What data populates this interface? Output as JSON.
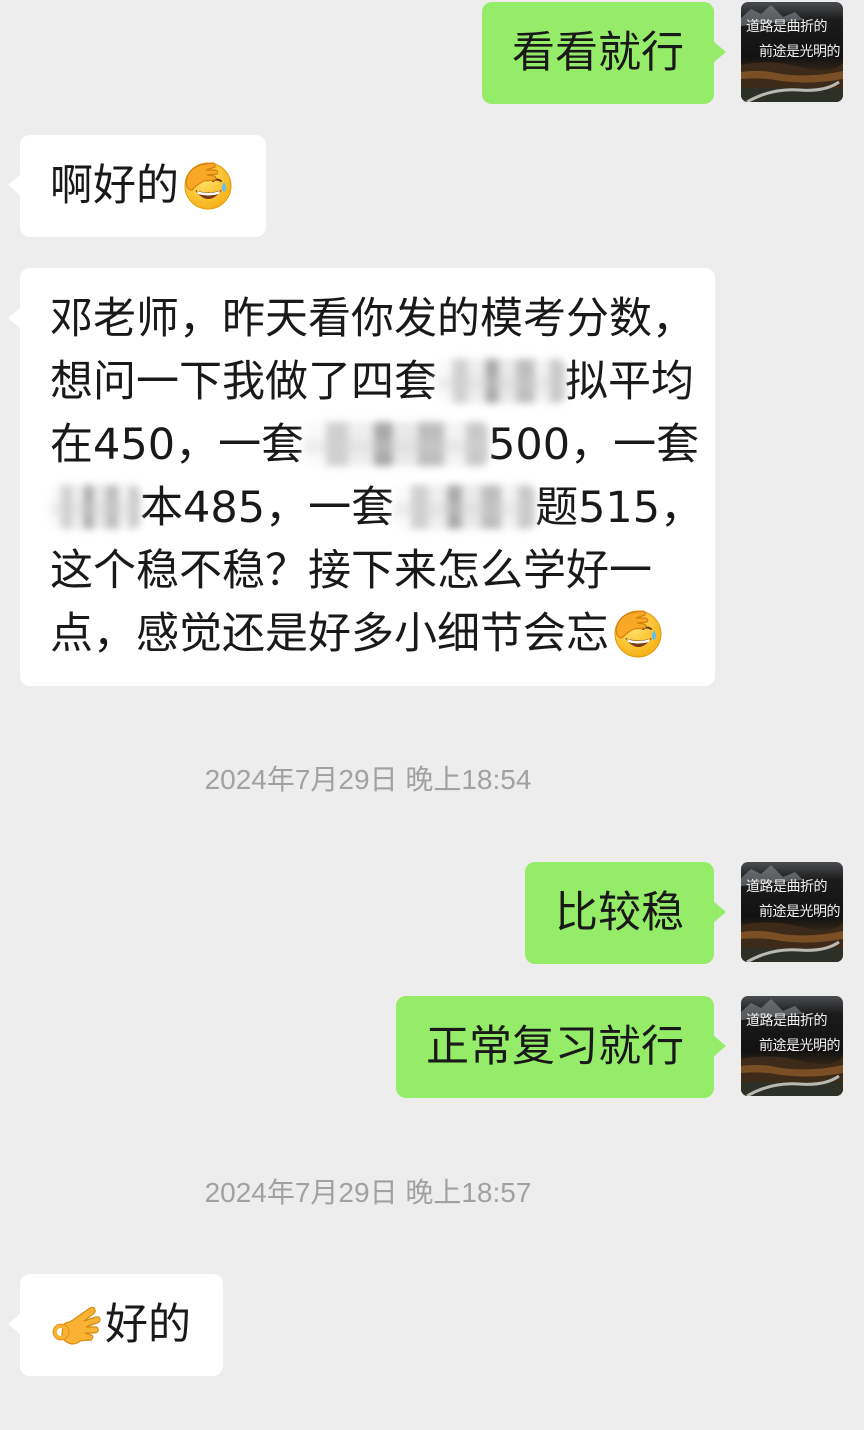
{
  "colors": {
    "background": "#ededed",
    "sent_bubble": "#95ec69",
    "received_bubble": "#ffffff",
    "message_text": "#191919",
    "timestamp_text": "#a1a1a1"
  },
  "avatar": {
    "caption_line1": "道路是曲折的",
    "caption_line2": "前途是光明的"
  },
  "items": [
    {
      "sent_message": {
        "text": "看看就行"
      }
    },
    {
      "received_message": {
        "text": "啊好的",
        "emoji": "facepalm-emoji"
      }
    },
    {
      "received_message": {
        "lines": [
          [
            {
              "text": "邓老师，昨天看你发的模考分数，"
            }
          ],
          [
            {
              "text": "想问一下我做了四套"
            },
            {
              "redacted": true
            },
            {
              "text": "拟平均"
            }
          ],
          [
            {
              "text": "在450，一套"
            },
            {
              "redacted": true
            },
            {
              "text": "500，一套"
            }
          ],
          [
            {
              "redacted": true
            },
            {
              "text": "本485，一套"
            },
            {
              "redacted": true
            },
            {
              "text": "题515，"
            }
          ],
          [
            {
              "text": "这个稳不稳？接下来怎么学好一"
            }
          ],
          [
            {
              "text": "点，感觉还是好多小细节会忘"
            }
          ]
        ],
        "emoji": "facepalm-emoji"
      }
    },
    {
      "timestamp": "2024年7月29日 晚上18:54"
    },
    {
      "sent_message": {
        "text": "比较稳"
      }
    },
    {
      "sent_message": {
        "text": "正常复习就行"
      }
    },
    {
      "timestamp": "2024年7月29日 晚上18:57"
    },
    {
      "received_message": {
        "emoji": "ok-hand-emoji",
        "text": "好的"
      }
    }
  ]
}
